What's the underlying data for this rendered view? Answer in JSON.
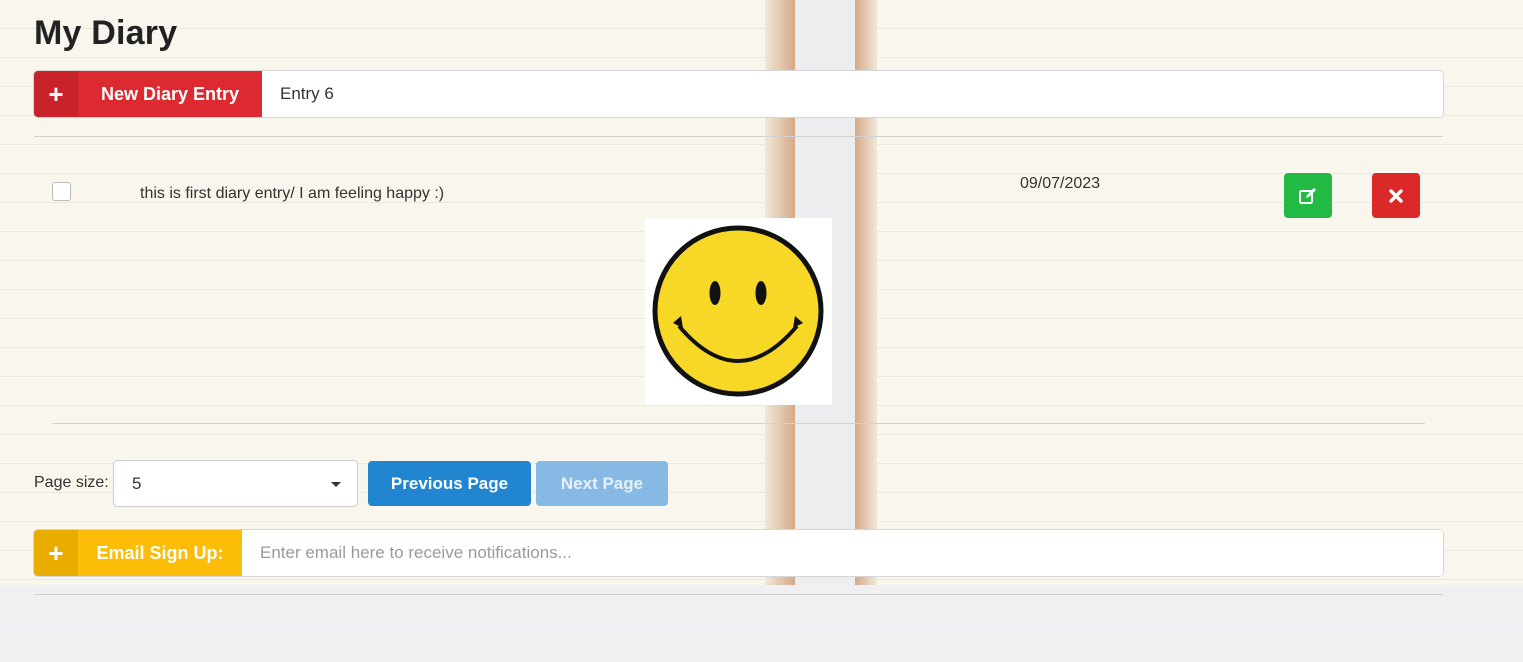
{
  "app": {
    "title": "My Diary"
  },
  "new_entry": {
    "label": "New Diary Entry",
    "value": "Entry 6",
    "plus_icon": "plus-icon"
  },
  "entries": [
    {
      "text": "this is first diary entry/ I am feeling happy :)",
      "date": "09/07/2023",
      "checked": false,
      "image_icon": "smiley-face"
    }
  ],
  "pagination": {
    "page_size_label": "Page size:",
    "page_size": "5",
    "prev_label": "Previous Page",
    "next_label": "Next Page",
    "next_disabled": true
  },
  "email_signup": {
    "label": "Email Sign Up:",
    "placeholder": "Enter email here to receive notifications..."
  },
  "colors": {
    "red": "#db2828",
    "green": "#21ba45",
    "blue": "#2185d0",
    "yellow": "#fbbd08"
  },
  "icons": {
    "edit": "edit-icon",
    "delete": "close-icon",
    "dropdown": "caret-down-icon"
  }
}
